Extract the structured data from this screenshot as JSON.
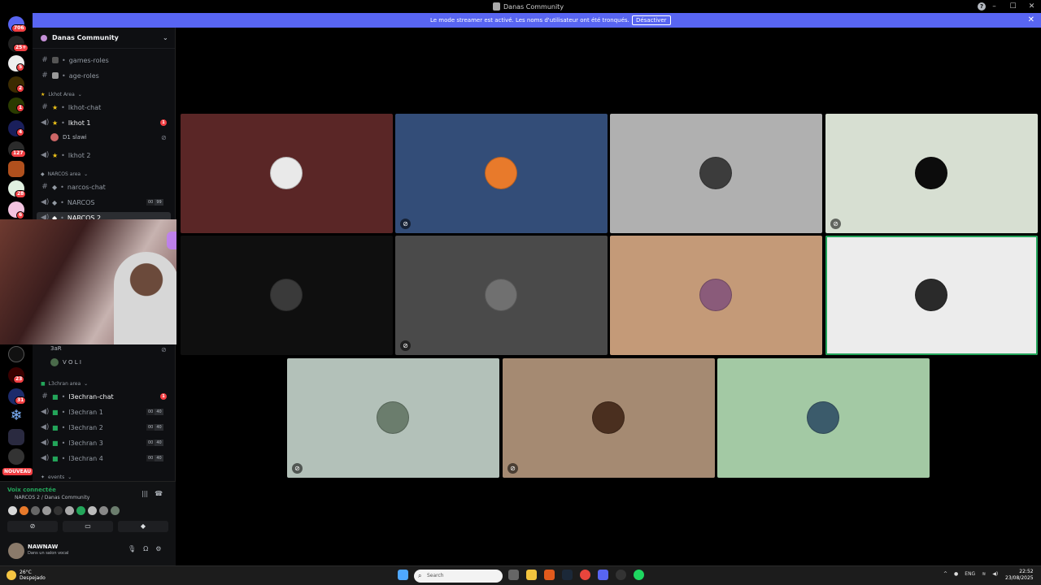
{
  "window": {
    "title": "Danas Community"
  },
  "banner": {
    "message": "Le mode streamer est activé. Les noms d'utilisateur ont été tronqués.",
    "button": "Désactiver"
  },
  "servers": {
    "badges": [
      "706",
      "25+",
      "5",
      "2",
      "1",
      "4",
      "127",
      "28",
      "6",
      "23",
      "31"
    ],
    "new_label": "NOUVEAU"
  },
  "guild": {
    "name": "Danas Community"
  },
  "channels": {
    "games_roles": "games-roles",
    "age_roles": "age-roles",
    "cat_lkhot": "Lkhot Area",
    "lkhot_chat": "lkhot-chat",
    "lkhot1": "lkhot 1",
    "lkhot1_user": "D1 slawi",
    "lkhot2": "lkhot 2",
    "cat_narcos": "NARCOS area",
    "narcos_chat": "narcos-chat",
    "narcos": "NARCOS",
    "narcos_count": [
      "00",
      "99"
    ],
    "narcos2": "NARCOS 2",
    "voice_user_a": "3aR",
    "voice_user_b": "V O L I",
    "cat_lechran": "L3chran area",
    "lechran_chat": "l3echran-chat",
    "lechran1": "l3echran 1",
    "lechran2": "l3echran 2",
    "lechran3": "l3echran 3",
    "lechran4": "l3echran 4",
    "lechran_count": [
      "00",
      "40"
    ],
    "cat_events": "events",
    "mention_count": "1"
  },
  "voice": {
    "connected": "Voix connectée",
    "location": "NARCOS 2 / Danas Community"
  },
  "user": {
    "name": "NAWNAW",
    "status": "Dans un salon vocal"
  },
  "tiles": [
    {
      "bg": "#5a2626",
      "avatar": "#e9e9e9",
      "muted": false,
      "speaking": false
    },
    {
      "bg": "#334d78",
      "avatar": "#e87a2b",
      "muted": true,
      "speaking": false
    },
    {
      "bg": "#b0b0b0",
      "avatar": "#3c3c3c",
      "muted": false,
      "speaking": false
    },
    {
      "bg": "#d7dfd2",
      "avatar": "#0c0c0c",
      "muted": true,
      "speaking": false
    },
    {
      "bg": "#0f0f0f",
      "avatar": "#3a3a3a",
      "muted": false,
      "speaking": false
    },
    {
      "bg": "#4a4a4a",
      "avatar": "#707070",
      "muted": true,
      "speaking": false
    },
    {
      "bg": "#c49a78",
      "avatar": "#8a5b7a",
      "muted": false,
      "speaking": false
    },
    {
      "bg": "#ececec",
      "avatar": "#2a2a2a",
      "muted": false,
      "speaking": true
    },
    {
      "bg": "#b3c1b9",
      "avatar": "#6b7d6d",
      "muted": true,
      "speaking": false
    },
    {
      "bg": "#a58a72",
      "avatar": "#4a2f1f",
      "muted": true,
      "speaking": false
    },
    {
      "bg": "#a3c9a4",
      "avatar": "#3b5b6b",
      "muted": false,
      "speaking": false
    }
  ],
  "taskbar": {
    "temp": "26°C",
    "weather": "Despejado",
    "search_placeholder": "Search",
    "lang": "ENG",
    "time": "22:52",
    "date": "23/08/2025"
  }
}
